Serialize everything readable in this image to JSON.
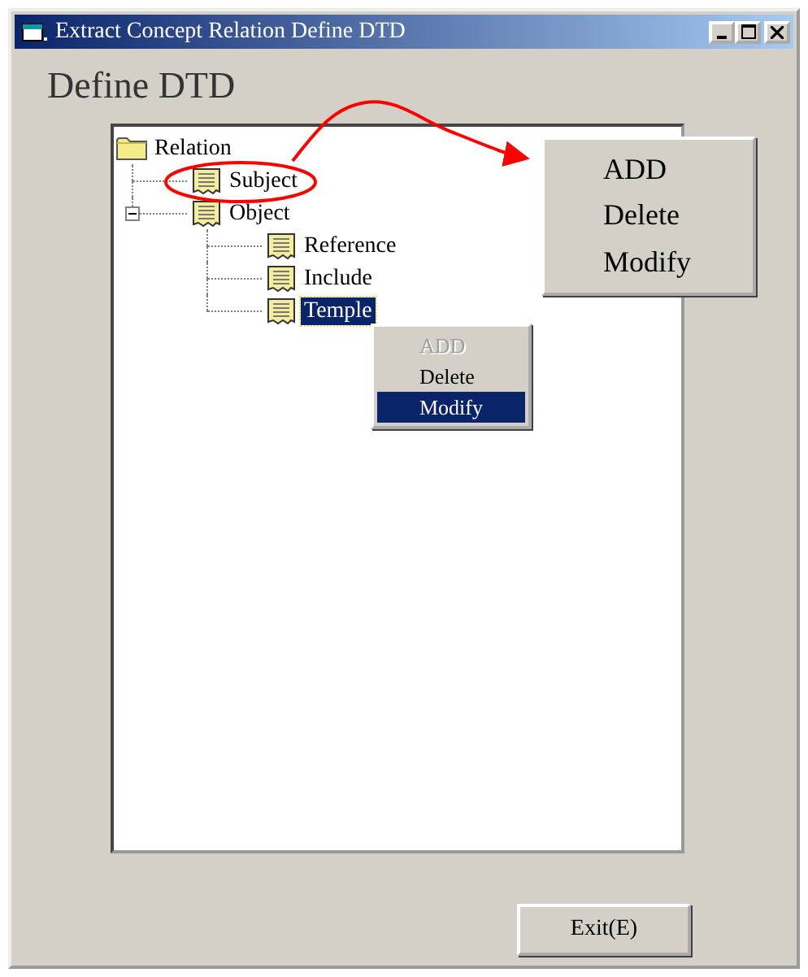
{
  "window": {
    "title": "Extract Concept Relation Define DTD"
  },
  "heading": "Define DTD",
  "tree": [
    {
      "label": "Relation",
      "kind": "folder",
      "selected": false,
      "children": [
        {
          "label": "Subject",
          "kind": "document",
          "selected": false
        },
        {
          "label": "Object",
          "kind": "document",
          "selected": false,
          "expanded": true,
          "children": [
            {
              "label": "Reference",
              "kind": "document",
              "selected": false
            },
            {
              "label": "Include",
              "kind": "document",
              "selected": false
            },
            {
              "label": "Temple",
              "kind": "document",
              "selected": true
            }
          ]
        }
      ]
    }
  ],
  "context_menu": {
    "items": [
      {
        "label": "ADD",
        "disabled": true,
        "selected": false
      },
      {
        "label": "Delete",
        "disabled": false,
        "selected": false
      },
      {
        "label": "Modify",
        "disabled": false,
        "selected": true
      }
    ]
  },
  "callout_menu": {
    "items": [
      {
        "label": "ADD",
        "disabled": false,
        "selected": false
      },
      {
        "label": "Delete",
        "disabled": false,
        "selected": false
      },
      {
        "label": "Modify",
        "disabled": false,
        "selected": false
      }
    ]
  },
  "exit_button": "Exit(E)"
}
